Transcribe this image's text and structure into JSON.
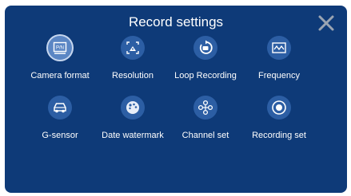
{
  "header": {
    "title": "Record settings"
  },
  "menu": [
    {
      "label": "Camera format",
      "icon": "pn-format-icon"
    },
    {
      "label": "Resolution",
      "icon": "resolution-icon"
    },
    {
      "label": "Loop Recording",
      "icon": "loop-recording-icon"
    },
    {
      "label": "Frequency",
      "icon": "frequency-icon"
    },
    {
      "label": "G-sensor",
      "icon": "car-sensor-icon"
    },
    {
      "label": "Date watermark",
      "icon": "watermark-icon"
    },
    {
      "label": "Channel set",
      "icon": "channel-icon"
    },
    {
      "label": "Recording set",
      "icon": "record-icon"
    }
  ],
  "pn_icon_text": "P/N",
  "colors": {
    "background": "#0e3a78",
    "icon_circle": "#2c5ea4",
    "selected_circle": "#5b86c4",
    "close": "#9aa4b2"
  }
}
